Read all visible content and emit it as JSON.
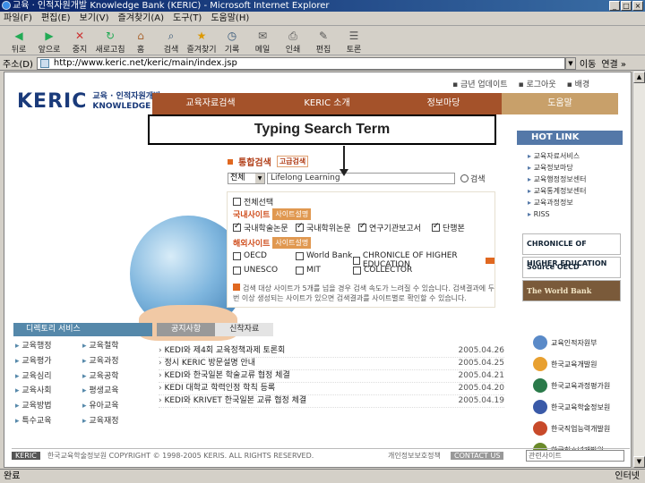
{
  "window": {
    "title": "교육 · 인적자원개발 Knowledge Bank (KERIC) - Microsoft Internet Explorer",
    "buttons": [
      "_",
      "□",
      "×"
    ]
  },
  "menubar": [
    "파일(F)",
    "편집(E)",
    "보기(V)",
    "즐겨찾기(A)",
    "도구(T)",
    "도움말(H)"
  ],
  "toolbar": [
    {
      "label": "뒤로",
      "icon": "back-icon"
    },
    {
      "label": "앞으로",
      "icon": "forward-icon"
    },
    {
      "label": "중지",
      "icon": "stop-icon"
    },
    {
      "label": "새로고침",
      "icon": "refresh-icon"
    },
    {
      "label": "홈",
      "icon": "home-icon"
    },
    {
      "label": "검색",
      "icon": "search-icon"
    },
    {
      "label": "즐겨찾기",
      "icon": "favorites-icon"
    },
    {
      "label": "기록",
      "icon": "history-icon"
    },
    {
      "label": "메일",
      "icon": "mail-icon"
    },
    {
      "label": "인쇄",
      "icon": "print-icon"
    },
    {
      "label": "편집",
      "icon": "edit-icon"
    },
    {
      "label": "토론",
      "icon": "discuss-icon"
    }
  ],
  "address": {
    "label": "주소(D)",
    "url": "http://www.keric.net/keric/main/index.jsp",
    "go": "이동",
    "links": "연결 »"
  },
  "page": {
    "toplinks": [
      "▪ 금년 업데이트",
      "▪ 로그아웃",
      "▪ 배경"
    ],
    "logo": {
      "main": "KERIC",
      "sub1": "교육 · 인적자원개발",
      "sub2": "KNOWLEDGE BANK"
    },
    "nav": [
      "교육자료검색",
      "KERIC 소개",
      "정보마당",
      "도움말"
    ],
    "callout": "Typing Search Term",
    "search": {
      "heading": "통합검색",
      "chip": "고급검색",
      "select": "전체",
      "term": "Lifelong Learning",
      "button": "검색"
    },
    "options": {
      "all": "전체선택",
      "domestic_label": "국내사이트",
      "domestic_chip": "사이트설명",
      "domestic": [
        {
          "label": "국내학술논문",
          "checked": true
        },
        {
          "label": "국내학위논문",
          "checked": true
        },
        {
          "label": "연구기관보고서",
          "checked": true
        },
        {
          "label": "단행본",
          "checked": true
        }
      ],
      "foreign_label": "해외사이트",
      "foreign_chip": "사이트설명",
      "foreign": [
        {
          "label": "OECD",
          "checked": false
        },
        {
          "label": "World Bank",
          "checked": false
        },
        {
          "label": "CHRONICLE OF HIGHER EDUCATION",
          "checked": false
        },
        {
          "label": "UNESCO",
          "checked": false
        },
        {
          "label": "MIT",
          "checked": false
        },
        {
          "label": "COLLECTOR",
          "checked": false
        }
      ]
    },
    "notice": "검색 대상 사이트가 5개를 넘을 경우 검색 속도가 느려질 수 있습니다. 검색결과에 두 번 이상 생성되는 사이트가 있으면 검색결과를 사이트별로 확인할 수 있습니다.",
    "hotlink": {
      "title": "HOT LINK",
      "items": [
        "교육자료서비스",
        "교육정보마당",
        "교육행정정보센터",
        "교육통계정보센터",
        "교육과정정보",
        "RISS"
      ]
    },
    "banners": [
      "CHRONICLE OF HIGHER EDUCATION",
      "Source OECD",
      "The World Bank"
    ],
    "cyber": {
      "title": "디렉토리 서비스",
      "items": [
        "교육행정",
        "교육철학",
        "교육평가",
        "교육과정",
        "교육심리",
        "교육공학",
        "교육사회",
        "평생교육",
        "교육방법",
        "유아교육",
        "특수교육",
        "교육재정"
      ]
    },
    "news": {
      "tabs": [
        "공지사항",
        "신착자료"
      ],
      "rows": [
        {
          "title": "KEDI와 제4회 교육정책과제 토론회",
          "date": "2005.04.26"
        },
        {
          "title": "정시 KERIC 방문설명 안내",
          "date": "2005.04.25"
        },
        {
          "title": "KEDI와 한국일본 학술교류 협정 체결",
          "date": "2005.04.21"
        },
        {
          "title": "KEDI 대학교 학력인정 학칙 등록",
          "date": "2005.04.20"
        },
        {
          "title": "KEDI와 KRIVET 한국일본 교류 협정 체결",
          "date": "2005.04.19"
        }
      ]
    },
    "orgs": [
      "교육인적자원부",
      "한국교육개발원",
      "한국교육과정평가원",
      "한국교육학술정보원",
      "한국직업능력개발원",
      "한국청소년개발원"
    ],
    "footer": {
      "brand": "KERIC",
      "copyright": "한국교육학술정보원  COPYRIGHT © 1998-2005 KERIS. ALL RIGHTS RESERVED.",
      "links": "개인정보보호정책",
      "contact": "CONTACT US",
      "related": "관련사이트"
    }
  },
  "status": {
    "left": "완료",
    "zone": "인터넷"
  }
}
